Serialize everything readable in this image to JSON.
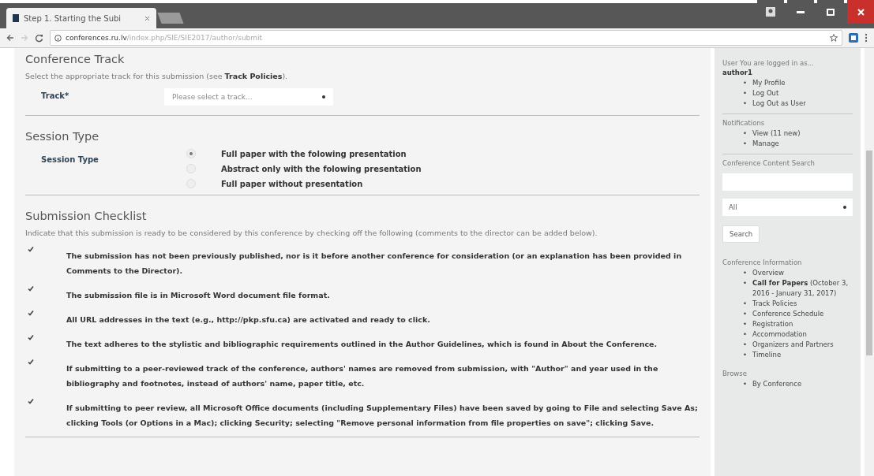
{
  "browser": {
    "tab_title": "Step 1. Starting the Subi",
    "url_host": "conferences.ru.lv",
    "url_path": "/index.php/SIE/SIE2017/author/submit"
  },
  "track": {
    "heading": "Conference Track",
    "description": "Select the appropriate track for this submission (see **Track Policies**).",
    "label": "Track*",
    "placeholder": "Please select a track..."
  },
  "session": {
    "heading": "Session Type",
    "label": "Session Type",
    "options": [
      {
        "label": "Full paper with the folowing presentation",
        "selected": true
      },
      {
        "label": "Abstract only with the folowing presentation",
        "selected": false
      },
      {
        "label": "Full paper without presentation",
        "selected": false
      }
    ]
  },
  "checklist": {
    "heading": "Submission Checklist",
    "description": "Indicate that this submission is ready to be considered by this conference by checking off the following (comments to the director can be added below).",
    "items": [
      {
        "text": "The submission has not been previously published, nor is it before another conference for consideration (or an explanation has been provided in Comments to the Director).",
        "checked": true
      },
      {
        "text": "The submission file is in Microsoft Word document file format.",
        "checked": true
      },
      {
        "text": "All URL addresses in the text (e.g., http://pkp.sfu.ca) are activated and ready to click.",
        "checked": true
      },
      {
        "text": "The text adheres to the stylistic and bibliographic requirements outlined in the Author Guidelines, which is found in About the Conference.",
        "checked": true
      },
      {
        "text": "If submitting to a peer-reviewed track of the conference, authors' names are removed from submission, with \"Author\" and year used in the bibliography and footnotes, instead of authors' name, paper title, etc.",
        "checked": true
      },
      {
        "text": "If submitting to peer review, all Microsoft Office documents (including Supplementary Files) have been saved by going to File and selecting Save As; clicking Tools (or Options in a Mac); clicking Security; selecting \"Remove personal information from file properties on save\"; clicking Save.",
        "checked": true
      }
    ]
  },
  "sidebar": {
    "user": {
      "label": "User You are logged in as...",
      "username": "author1",
      "links": [
        {
          "bullet": "•",
          "text": "My Profile"
        },
        {
          "bullet": "•",
          "text": "Log Out"
        },
        {
          "bullet": "•",
          "text": "Log Out as User"
        }
      ]
    },
    "notifications": {
      "label": "Notifications",
      "links": [
        {
          "bullet": "•",
          "text": "View (11 new)"
        },
        {
          "bullet": "•",
          "text": "Manage"
        }
      ]
    },
    "search": {
      "label": "Conference Content Search",
      "scope": "All",
      "button": "Search"
    },
    "info": {
      "label": "Conference Information",
      "links": [
        {
          "bullet": "•",
          "text": "Overview"
        },
        {
          "bullet": "•",
          "text": "**Call for Papers** (October 3, 2016 - January 31, 2017)"
        },
        {
          "bullet": "•",
          "text": "Track Policies"
        },
        {
          "bullet": "•",
          "text": "Conference Schedule"
        },
        {
          "bullet": "•",
          "text": "Registration"
        },
        {
          "bullet": "•",
          "text": "Accommodation"
        },
        {
          "bullet": "•",
          "text": "Organizers and Partners"
        },
        {
          "bullet": "•",
          "text": "Timeline"
        }
      ]
    },
    "browse": {
      "label": "Browse",
      "links": [
        {
          "bullet": "•",
          "text": "By Conference"
        }
      ]
    }
  }
}
